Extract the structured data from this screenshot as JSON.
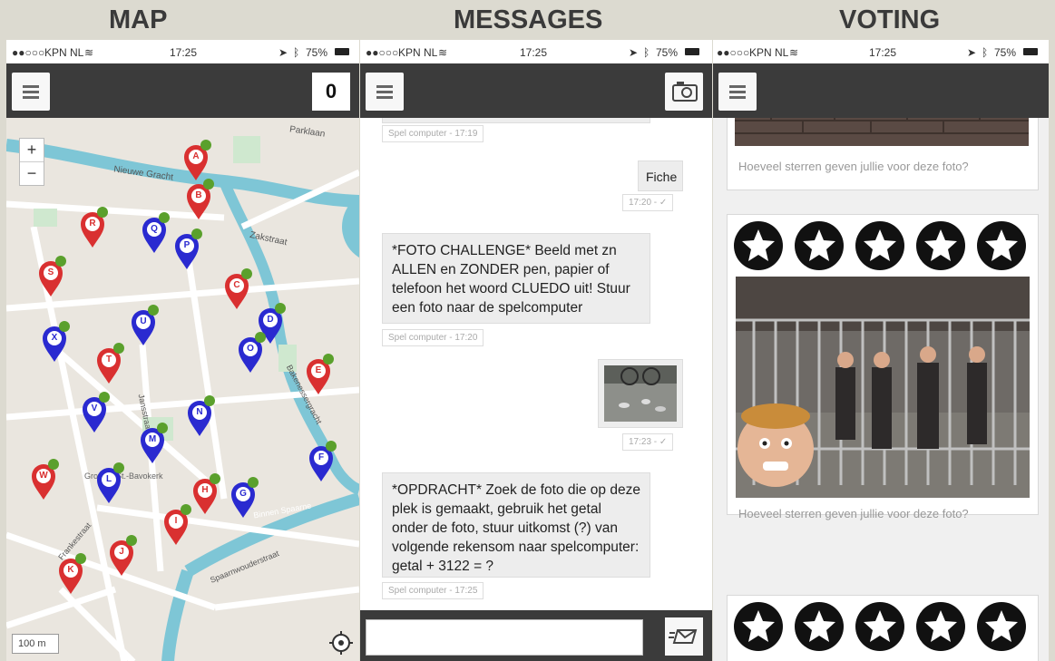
{
  "panels": {
    "map_title": "MAP",
    "messages_title": "MESSAGES",
    "voting_title": "VOTING"
  },
  "status": {
    "carrier": "KPN NL",
    "time": "17:25",
    "battery": "75%"
  },
  "map": {
    "score": "0",
    "zoom_in": "+",
    "zoom_out": "−",
    "scale": "100 m",
    "streets": [
      "Parklaan",
      "Nieuwe Gracht",
      "Zakstraat",
      "Bakenessergracht",
      "Grote of St.-Bavokerk",
      "Binnen Spaarne",
      "Spaarnwouderstraat",
      "Frankestraat",
      "Jansstraat"
    ],
    "pin_colors": {
      "red": "#d93030",
      "blue": "#2a2ad0",
      "done": "#5aa02c"
    },
    "pins": [
      {
        "label": "A",
        "color": "red"
      },
      {
        "label": "B",
        "color": "red"
      },
      {
        "label": "R",
        "color": "red"
      },
      {
        "label": "Q",
        "color": "blue"
      },
      {
        "label": "P",
        "color": "blue"
      },
      {
        "label": "S",
        "color": "red"
      },
      {
        "label": "C",
        "color": "red"
      },
      {
        "label": "U",
        "color": "blue"
      },
      {
        "label": "D",
        "color": "blue"
      },
      {
        "label": "X",
        "color": "blue"
      },
      {
        "label": "O",
        "color": "blue"
      },
      {
        "label": "T",
        "color": "red"
      },
      {
        "label": "E",
        "color": "red"
      },
      {
        "label": "V",
        "color": "blue"
      },
      {
        "label": "N",
        "color": "blue"
      },
      {
        "label": "M",
        "color": "blue"
      },
      {
        "label": "F",
        "color": "blue"
      },
      {
        "label": "W",
        "color": "red"
      },
      {
        "label": "L",
        "color": "blue"
      },
      {
        "label": "H",
        "color": "red"
      },
      {
        "label": "G",
        "color": "blue"
      },
      {
        "label": "I",
        "color": "red"
      },
      {
        "label": "J",
        "color": "red"
      },
      {
        "label": "K",
        "color": "red"
      }
    ]
  },
  "messages": {
    "items": [
      {
        "meta": "Spel computer - 17:19"
      },
      {
        "text": "Fiche",
        "meta": "17:20 - ✓"
      },
      {
        "text": "*FOTO CHALLENGE* Beeld met zn ALLEN en ZONDER pen, papier of telefoon het woord CLUEDO uit! Stuur een foto naar de spelcomputer",
        "meta": "Spel computer - 17:20"
      },
      {
        "meta": "17:23 - ✓"
      },
      {
        "text": "*OPDRACHT* Zoek de foto die op deze plek is gemaakt, gebruik het getal onder de foto, stuur uitkomst (?) van volgende rekensom naar spelcomputer: getal + 3122 = ?",
        "meta": "Spel computer - 17:25"
      }
    ],
    "input_value": ""
  },
  "voting": {
    "question": "Hoeveel sterren geven jullie voor deze foto?",
    "rating": 0,
    "max_rating": 5
  }
}
